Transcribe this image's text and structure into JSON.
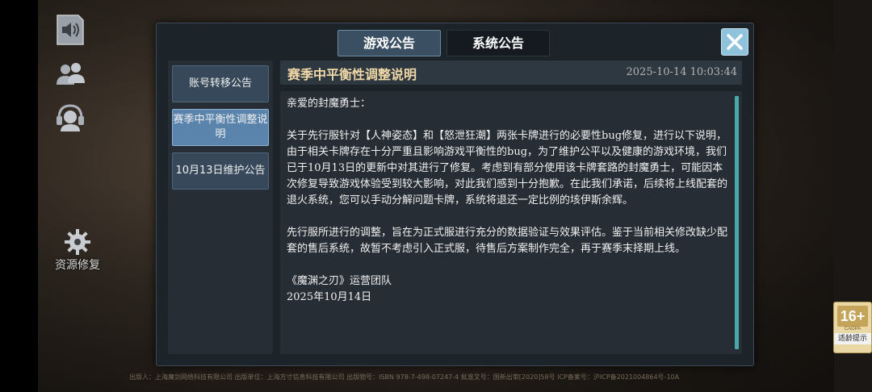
{
  "sidebar_left": {
    "icons": [
      "speaker-icon",
      "friends-icon",
      "customer-service-icon"
    ],
    "repair_label": "资源修复"
  },
  "footer_text": "出版人：上海魔剑网络科技有限公司 出版单位：上海方寸信息科技有限公司 出版物号：ISBN 978-7-498-07247-4 批准文号：国新出审[2020]58号 ICP备案号：沪ICP备2021004864号-10A",
  "age_badge": {
    "age": "16+",
    "org": "CADPA",
    "tip": "适龄提示"
  },
  "dialog": {
    "tabs": [
      {
        "label": "游戏公告",
        "active": true
      },
      {
        "label": "系统公告",
        "active": false
      }
    ],
    "list": [
      {
        "label": "账号转移公告",
        "selected": false
      },
      {
        "label": "赛季中平衡性调整说明",
        "selected": true
      },
      {
        "label": "10月13日维护公告",
        "selected": false
      }
    ],
    "notice": {
      "title": "赛季中平衡性调整说明",
      "datetime": "2025-10-14  10:03:44",
      "greeting": "亲爱的封魔勇士：",
      "para1": "关于先行服针对【人神姿态】和【怒泄狂潮】两张卡牌进行的必要性bug修复，进行以下说明，由于相关卡牌存在十分严重且影响游戏平衡性的bug，为了维护公平以及健康的游戏环境，我们已于10月13日的更新中对其进行了修复。考虑到有部分使用该卡牌套路的封魔勇士，可能因本次修复导致游戏体验受到较大影响，对此我们感到十分抱歉。在此我们承诺，后续将上线配套的退火系统，您可以手动分解问题卡牌，系统将退还一定比例的垓伊斯余辉。",
      "para2": "先行服所进行的调整，旨在为正式服进行充分的数据验证与效果评估。鉴于当前相关修改缺少配套的售后系统，故暂不考虑引入正式服，待售后方案制作完全，再于赛季末择期上线。",
      "signature": "《魔渊之刃》运营团队",
      "sign_date": "2025年10月14日"
    }
  },
  "colors": {
    "accent": "#8fc3dc",
    "title": "#f1d9a8",
    "scrollbar": "#4aa9a8"
  }
}
